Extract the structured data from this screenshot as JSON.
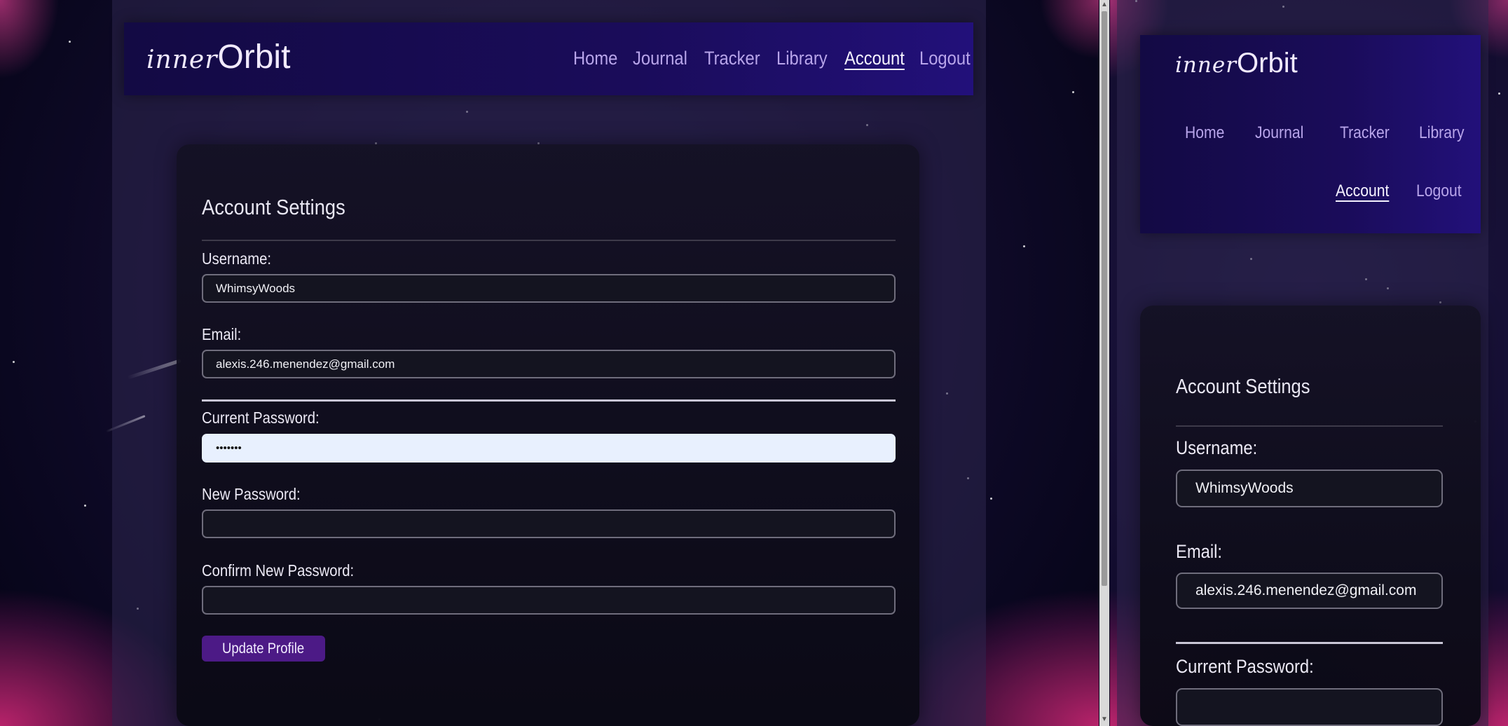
{
  "logo": {
    "part1": "inner",
    "part2": "Orbit"
  },
  "nav": {
    "home": "Home",
    "journal": "Journal",
    "tracker": "Tracker",
    "library": "Library",
    "account": "Account",
    "logout": "Logout",
    "active": "Account"
  },
  "settings": {
    "title": "Account Settings",
    "username_label": "Username:",
    "username_value": "WhimsyWoods",
    "email_label": "Email:",
    "email_value": "alexis.246.menendez@gmail.com",
    "current_password_label": "Current Password:",
    "current_password_value": "•••••••",
    "new_password_label": "New Password:",
    "new_password_value": "",
    "confirm_password_label": "Confirm New Password:",
    "confirm_password_value": "",
    "submit_label": "Update Profile"
  },
  "colors": {
    "navbar": "#1a0c5a",
    "nav_link": "#b8a5ea",
    "button": "#4c1a86",
    "card": "#14111f",
    "autofill": "#e8f0fe"
  }
}
